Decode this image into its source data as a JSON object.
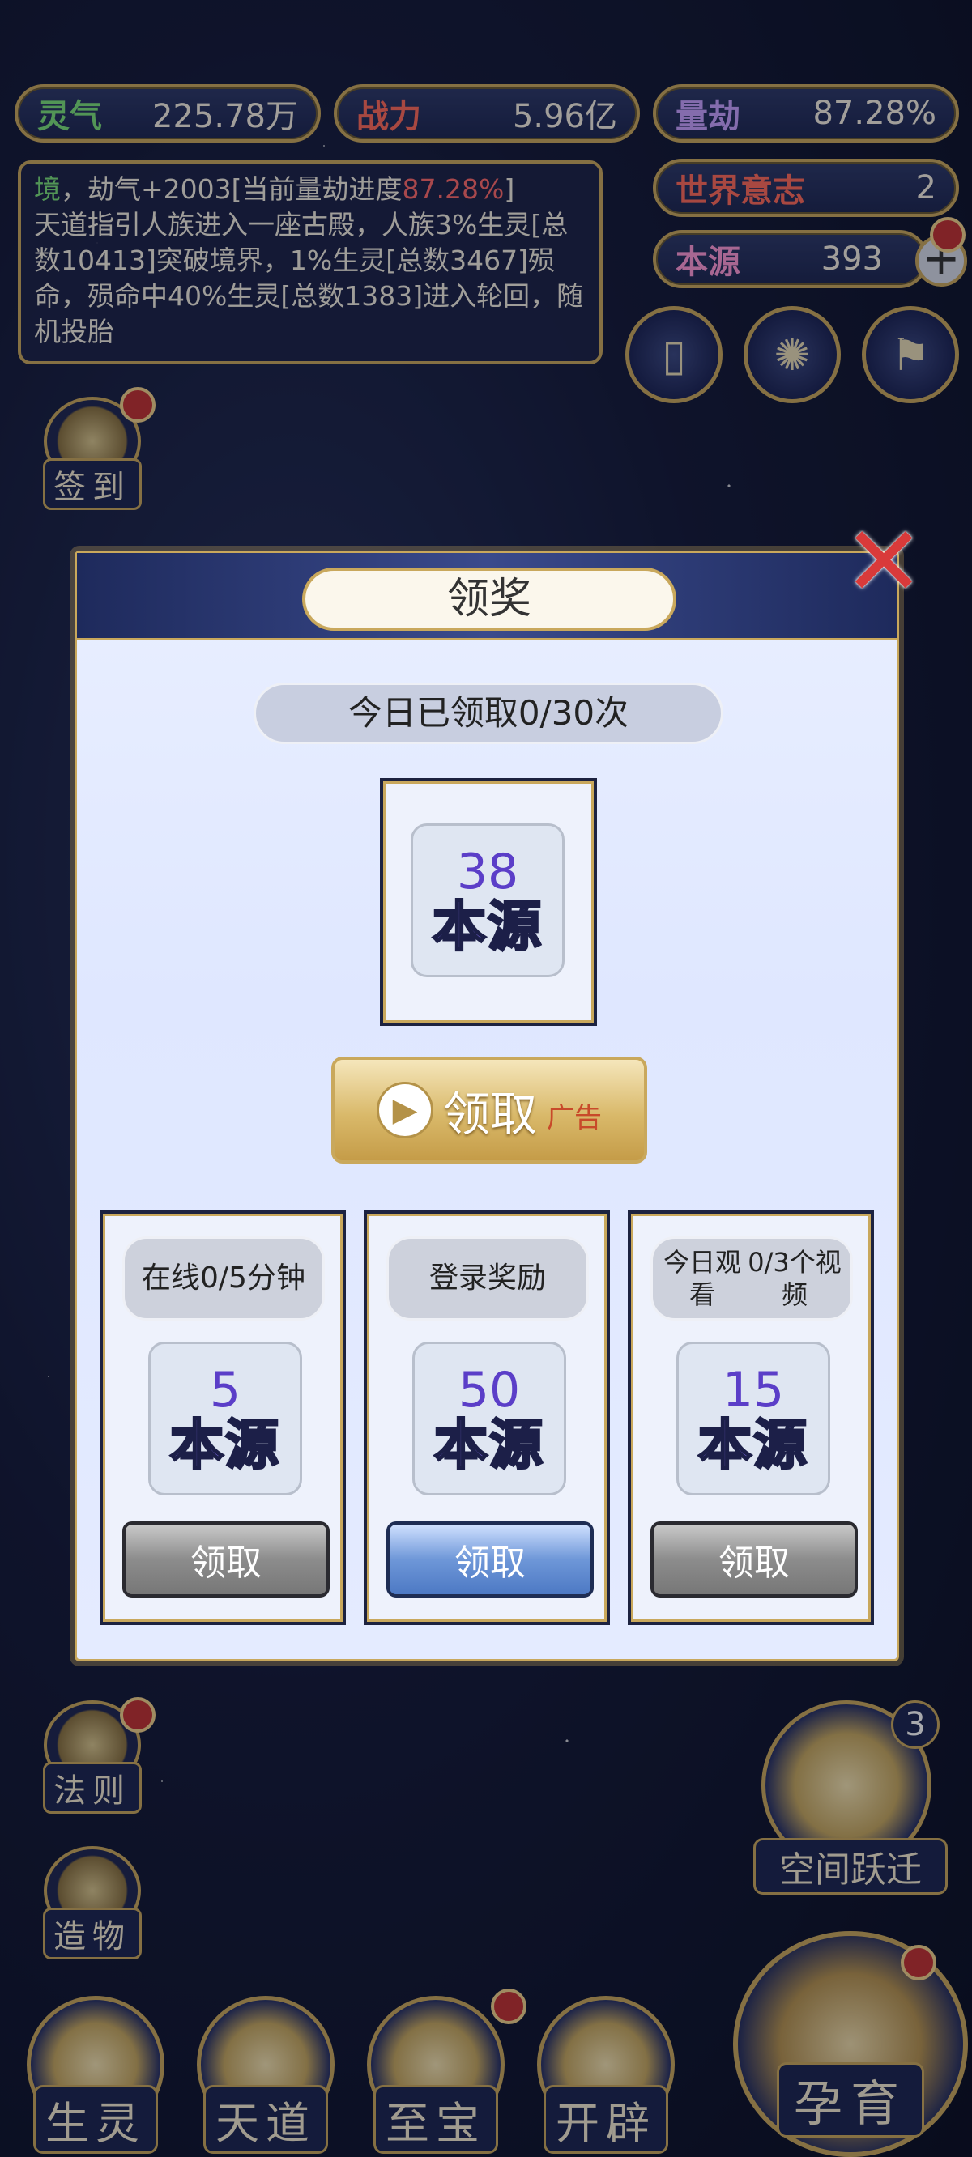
{
  "stats": {
    "lingqi": {
      "label": "灵气",
      "value": "225.78万"
    },
    "zhanli": {
      "label": "战力",
      "value": "5.96亿"
    },
    "liangjie": {
      "label": "量劫",
      "value": "87.28%"
    },
    "shijie": {
      "label": "世界意志",
      "value": "2"
    },
    "benyuan": {
      "label": "本源",
      "value": "393"
    }
  },
  "info": {
    "prefix_char": "境",
    "line1_a": "，劫气+2003[当前量劫进度",
    "line1_highlight": "87.28%",
    "line1_b": "]",
    "body": "天道指引人族进入一座古殿，人族3%生灵[总数10413]突破境界，1%生灵[总数3467]殒命，殒命中40%生灵[总数1383]进入轮回，随机投胎"
  },
  "side_left": {
    "signin": "签到",
    "fa_ze": "法则",
    "zao_wu": "造物"
  },
  "space_jump": {
    "label": "空间跃迁",
    "badge": "3"
  },
  "bottom_nav": {
    "sheng_ling": "生灵",
    "tian_dao": "天道",
    "zhi_bao": "至宝",
    "kai_pi": "开辟",
    "yun_yu": "孕育"
  },
  "modal": {
    "title": "领奖",
    "daily_count": "今日已领取0/30次",
    "main_reward": {
      "amount": "38",
      "unit": "本源"
    },
    "ad_button": {
      "label": "领取",
      "tag": "广告"
    },
    "tasks": [
      {
        "title": "在线0/5分钟",
        "amount": "5",
        "unit": "本源",
        "button": "领取",
        "state": "disabled"
      },
      {
        "title": "登录奖励",
        "amount": "50",
        "unit": "本源",
        "button": "领取",
        "state": "active"
      },
      {
        "title": "今日观看0/3个视频",
        "title_line1": "今日观看",
        "title_line2": "0/3个视频",
        "amount": "15",
        "unit": "本源",
        "button": "领取",
        "state": "disabled"
      }
    ]
  },
  "colors": {
    "gold_border": "#c9a85c",
    "highlight_red": "#ff6a6a",
    "reward_purple": "#5b3ec8"
  }
}
